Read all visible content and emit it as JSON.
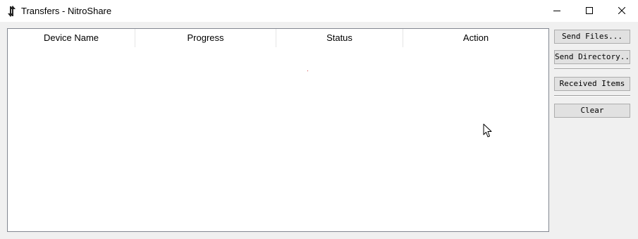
{
  "window": {
    "title": "Transfers - NitroShare",
    "app_icon": "nitroshare-icon",
    "controls": [
      "minimize-icon",
      "maximize-icon",
      "close-icon"
    ]
  },
  "transfers_table": {
    "columns": [
      "Device Name",
      "Progress",
      "Status",
      "Action"
    ],
    "rows": []
  },
  "side_panel": {
    "send_files": "Send Files...",
    "send_directory": "Send Directory...",
    "received_items": "Received Items",
    "clear": "Clear"
  },
  "colors": {
    "background": "#f0f0f0",
    "titlebar": "#ffffff",
    "button_face": "#e1e1e1",
    "button_border": "#adadad"
  }
}
